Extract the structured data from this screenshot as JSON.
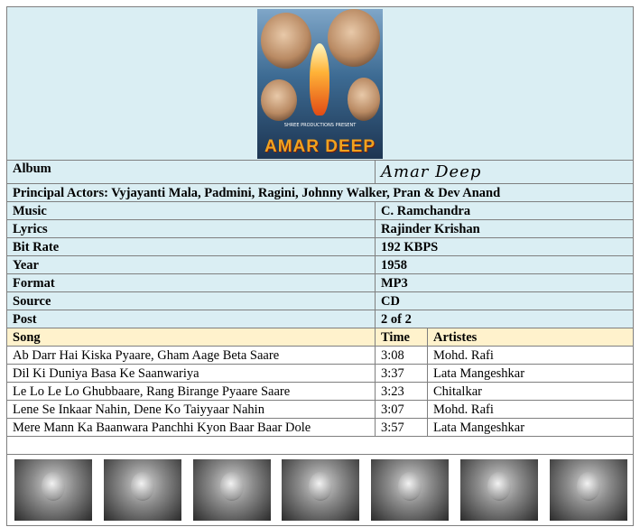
{
  "cover": {
    "title_art": "AMAR DEEP",
    "credit": "SHREE PRODUCTIONS PRESENT"
  },
  "album": {
    "label": "Album",
    "value": "Amar Deep"
  },
  "actors": "Principal Actors: Vyjayanti Mala, Padmini, Ragini, Johnny Walker, Pran & Dev Anand",
  "info_rows": [
    {
      "label": "Music",
      "value": "C. Ramchandra"
    },
    {
      "label": "Lyrics",
      "value": "Rajinder Krishan"
    },
    {
      "label": "Bit Rate",
      "value": "192 KBPS"
    },
    {
      "label": "Year",
      "value": "1958"
    },
    {
      "label": "Format",
      "value": "MP3"
    },
    {
      "label": "Source",
      "value": "CD"
    },
    {
      "label": "Post",
      "value": "2 of 2"
    }
  ],
  "songs_header": {
    "song": "Song",
    "time": "Time",
    "artistes": "Artistes"
  },
  "songs": [
    {
      "title": "Ab Darr Hai Kiska Pyaare, Gham Aage Beta Saare",
      "time": "3:08",
      "artist": "Mohd. Rafi"
    },
    {
      "title": "Dil Ki Duniya Basa Ke Saanwariya",
      "time": "3:37",
      "artist": "Lata Mangeshkar"
    },
    {
      "title": "Le Lo Le Lo Ghubbaare, Rang Birange Pyaare Saare",
      "time": "3:23",
      "artist": "Chitalkar"
    },
    {
      "title": "Lene Se Inkaar Nahin, Dene Ko Taiyyaar Nahin",
      "time": "3:07",
      "artist": "Mohd. Rafi"
    },
    {
      "title": "Mere Mann Ka Baanwara Panchhi Kyon Baar Baar Dole",
      "time": "3:57",
      "artist": "Lata Mangeshkar"
    }
  ]
}
